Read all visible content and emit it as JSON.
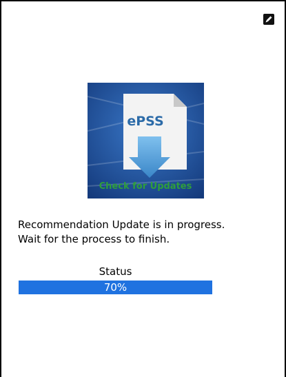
{
  "status_indicator": {
    "icon": "edit-mode-icon"
  },
  "logo": {
    "title": "ePSS",
    "caption": "Check for Updates",
    "colors": {
      "background": "#1e4d99",
      "document": "#f3f3f3",
      "arrow": "#4e9fd8",
      "title": "#2c6ba8",
      "caption": "#2f9e3c"
    }
  },
  "message": {
    "line1": "Recommendation Update is in progress.",
    "line2": "Wait for the process to finish."
  },
  "status": {
    "label": "Status",
    "progress_percent": 70,
    "progress_text": "70%",
    "bar_color": "#1f72e0"
  }
}
